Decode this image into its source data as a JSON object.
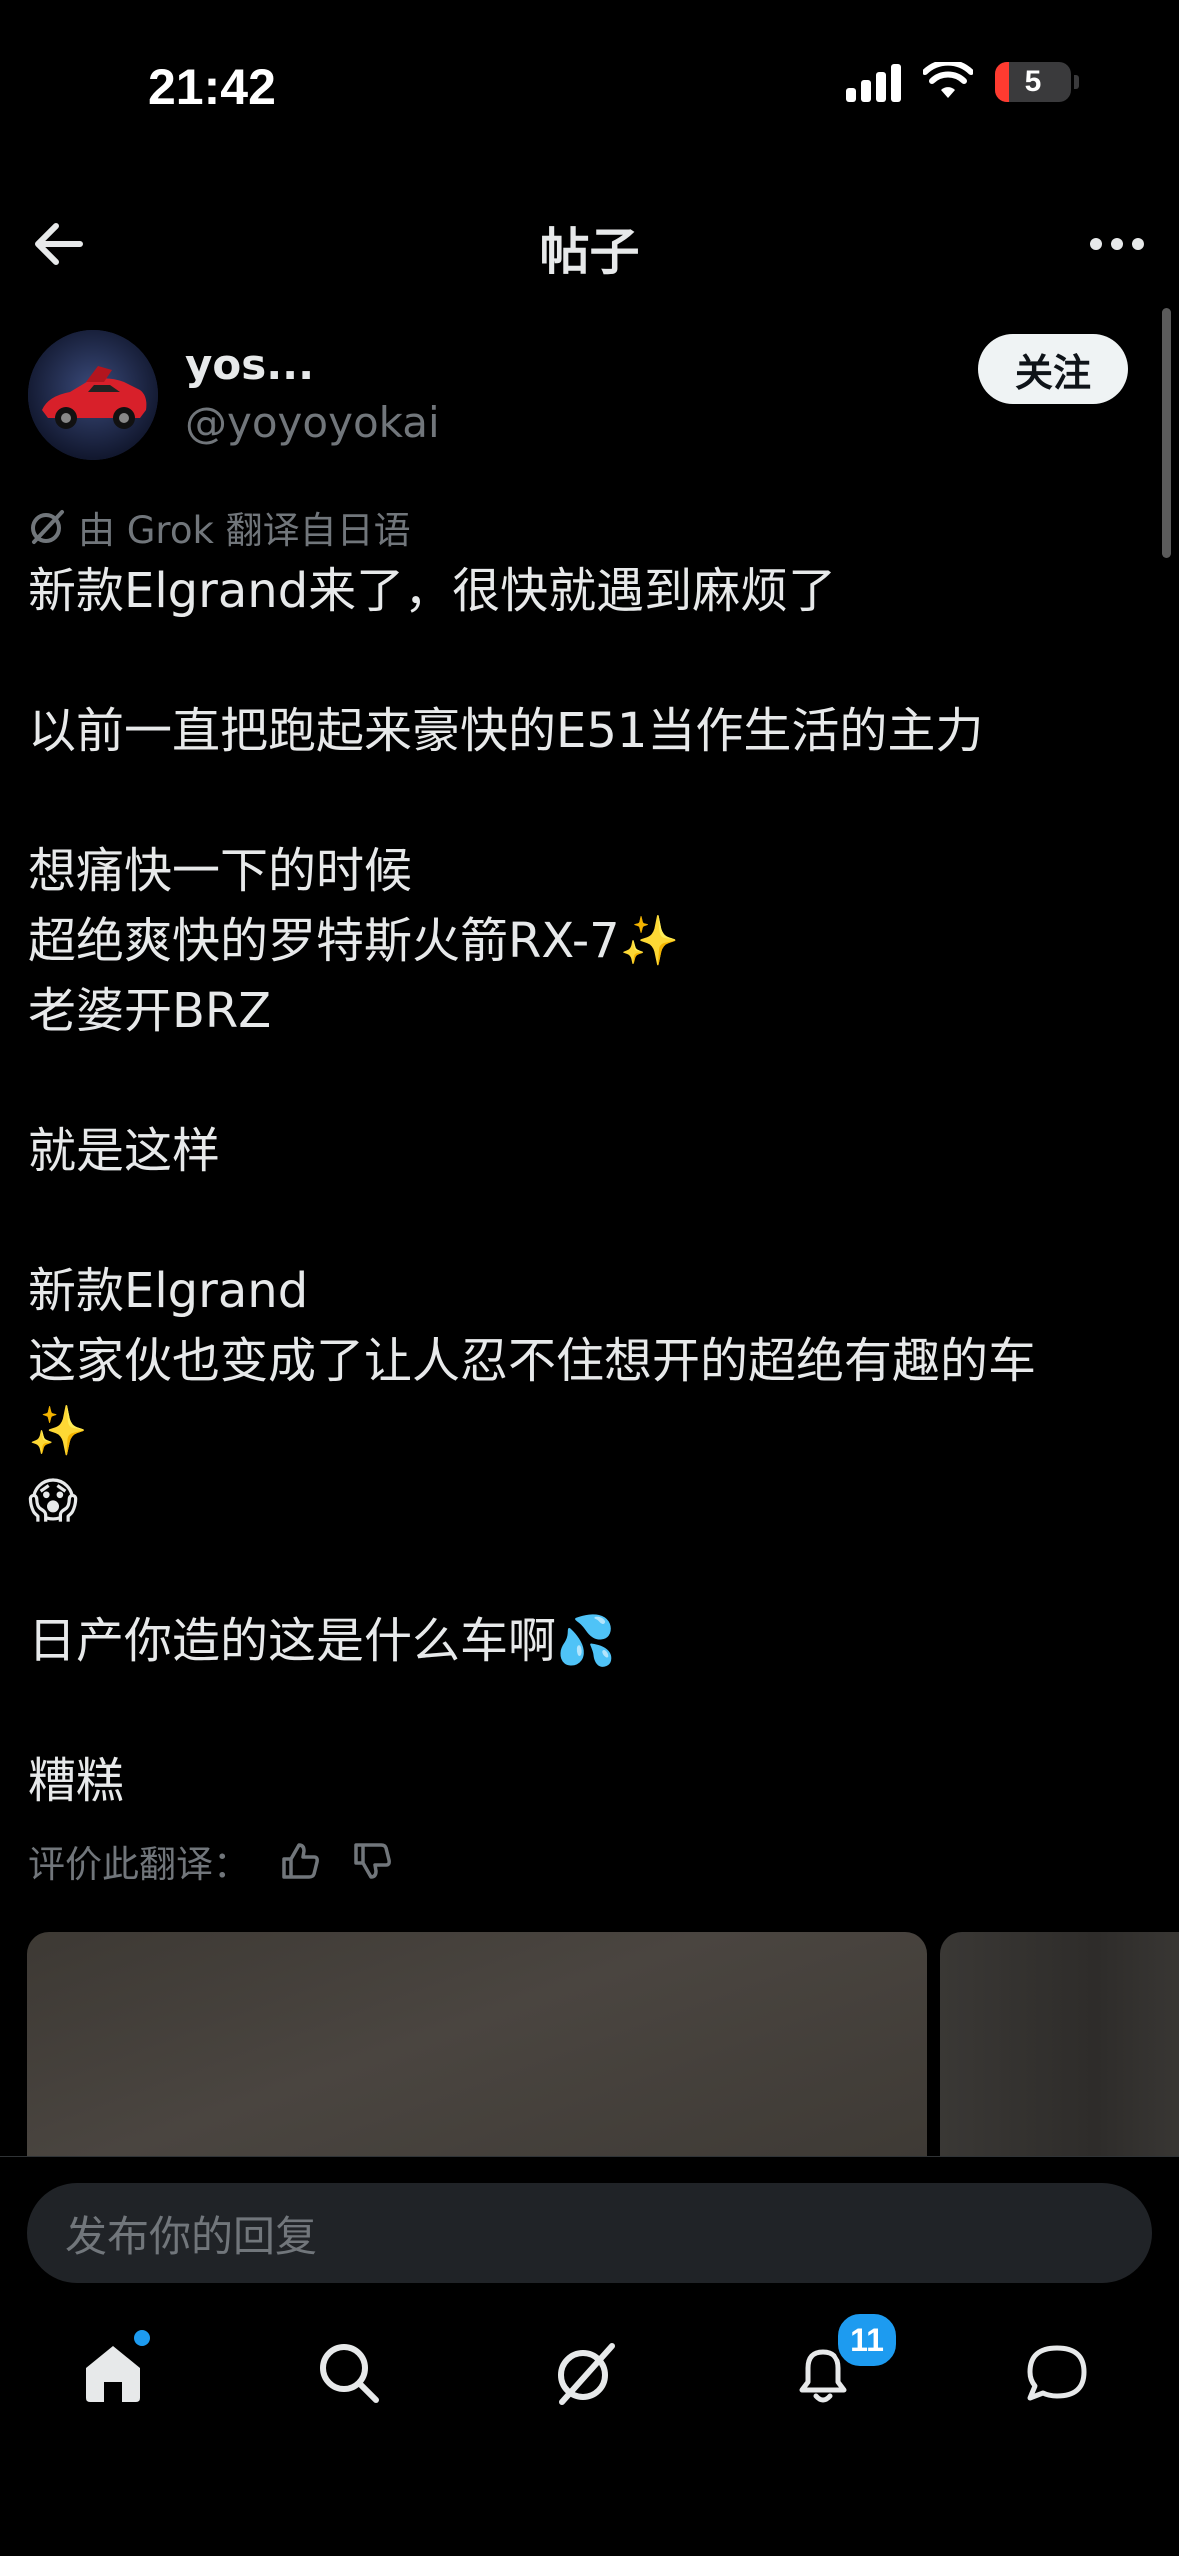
{
  "status_bar": {
    "time": "21:42",
    "battery_percent": "5"
  },
  "header": {
    "title": "帖子"
  },
  "author": {
    "name": "yos...",
    "handle": "@yoyoyokai",
    "follow_label": "关注"
  },
  "translation_note": "由 Grok 翻译自日语",
  "post_lines": [
    "新款Elgrand来了，很快就遇到麻烦了",
    "",
    "以前一直把跑起来豪快的E51当作生活的主力",
    "",
    "想痛快一下的时候",
    "超绝爽快的罗特斯火箭RX-7✨",
    "老婆开BRZ",
    "",
    "就是这样",
    "",
    "新款Elgrand",
    "这家伙也变成了让人忍不住想开的超绝有趣的车",
    "✨",
    "😱",
    "",
    "日产你造的这是什么车啊💦",
    "",
    "糟糕"
  ],
  "rate_translation_label": "评价此翻译：",
  "reply": {
    "placeholder": "发布你的回复"
  },
  "tab_bar": {
    "items": [
      "home-icon",
      "search-icon",
      "grok-icon",
      "bell-icon",
      "messages-icon"
    ],
    "notification_count": "11"
  },
  "colors": {
    "background": "#000000",
    "text": "#e7e9ea",
    "secondary_text": "#71767b",
    "accent": "#1d9bf0"
  }
}
